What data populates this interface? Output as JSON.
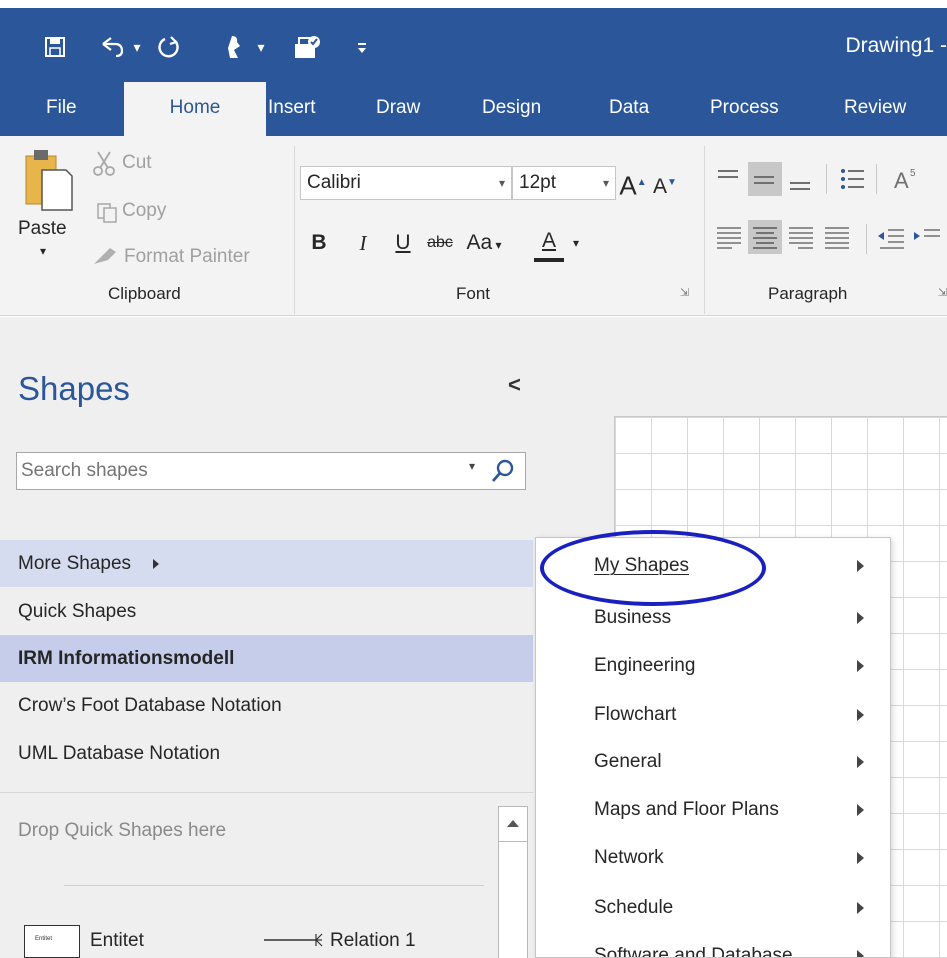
{
  "app": {
    "doc_title": "Drawing1  -"
  },
  "qat": {
    "save_icon": "save-icon",
    "undo_icon": "undo-icon",
    "redo_icon": "redo-icon",
    "pointer_icon": "pointer-tool-icon",
    "connector_icon": "connector-icon",
    "customize_icon": "customize-qat-icon"
  },
  "tabs": [
    {
      "label": "File"
    },
    {
      "label": "Home"
    },
    {
      "label": "Insert"
    },
    {
      "label": "Draw"
    },
    {
      "label": "Design"
    },
    {
      "label": "Data"
    },
    {
      "label": "Process"
    },
    {
      "label": "Review"
    }
  ],
  "ribbon": {
    "clipboard": {
      "paste_label": "Paste",
      "cut_label": "Cut",
      "copy_label": "Copy",
      "format_painter_label": "Format Painter",
      "group_label": "Clipboard"
    },
    "font": {
      "font_name": "Calibri",
      "font_size": "12pt",
      "bold": "B",
      "italic": "I",
      "underline": "U",
      "strikethrough": "abc",
      "change_case": "Aa",
      "font_color": "A",
      "grow": "A",
      "shrink": "A",
      "group_label": "Font"
    },
    "paragraph": {
      "group_label": "Paragraph"
    }
  },
  "shapes_pane": {
    "title": "Shapes",
    "collapse": "<",
    "search_placeholder": "Search shapes",
    "stencils": [
      {
        "label": "More Shapes"
      },
      {
        "label": "Quick Shapes"
      },
      {
        "label": "IRM Informationsmodell"
      },
      {
        "label": "Crow’s Foot Database Notation"
      },
      {
        "label": "UML Database Notation"
      }
    ],
    "drop_text": "Drop Quick Shapes here",
    "shape_items": [
      {
        "label": "Entitet",
        "thumb": "Entitet"
      },
      {
        "label": "Relation 1"
      }
    ]
  },
  "flyout": {
    "items": [
      {
        "label": "My Shapes"
      },
      {
        "label": "Business"
      },
      {
        "label": "Engineering"
      },
      {
        "label": "Flowchart"
      },
      {
        "label": "General"
      },
      {
        "label": "Maps and Floor Plans"
      },
      {
        "label": "Network"
      },
      {
        "label": "Schedule"
      },
      {
        "label": "Software and Database"
      }
    ]
  },
  "colors": {
    "brand_blue": "#2b579a",
    "ribbon_bg": "#f3f3f3",
    "highlight_ring": "#1a1fc0",
    "selected_stencil": "#c5cdea"
  }
}
